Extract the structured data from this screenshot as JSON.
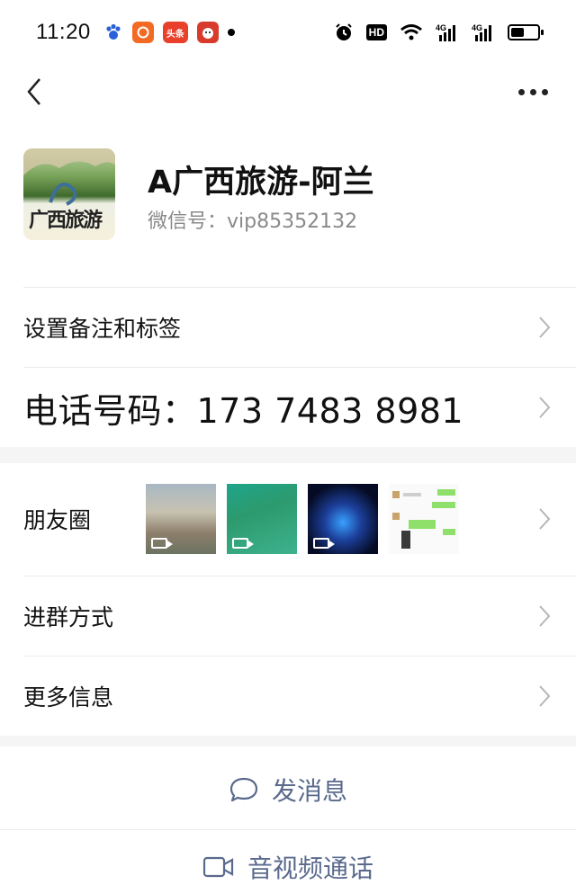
{
  "status_bar": {
    "time": "11:20",
    "app_badges": [
      "baidu-paw-icon",
      "weibo-icon",
      "toutiao-icon",
      "kuaidi-icon"
    ],
    "toutiao_label": "头条",
    "hd_label": "HD",
    "network_1": "4G",
    "network_2": "4G"
  },
  "nav": {
    "back_icon": "chevron-left-icon",
    "more_icon": "more-dots-icon"
  },
  "profile": {
    "name": "A广西旅游-阿兰",
    "wechat_id": "微信号：vip85352132",
    "avatar_text": "广西旅游"
  },
  "rows": {
    "remark": "设置备注和标签",
    "phone": "电话号码：173 7483 8981",
    "moments": "朋友圈",
    "join_group": "进群方式",
    "more_info": "更多信息"
  },
  "actions": {
    "send_message": "发消息",
    "video_call": "音视频通话"
  },
  "colors": {
    "link_blue": "#5a6a8d",
    "divider": "#ececec",
    "band": "#f5f5f5"
  }
}
